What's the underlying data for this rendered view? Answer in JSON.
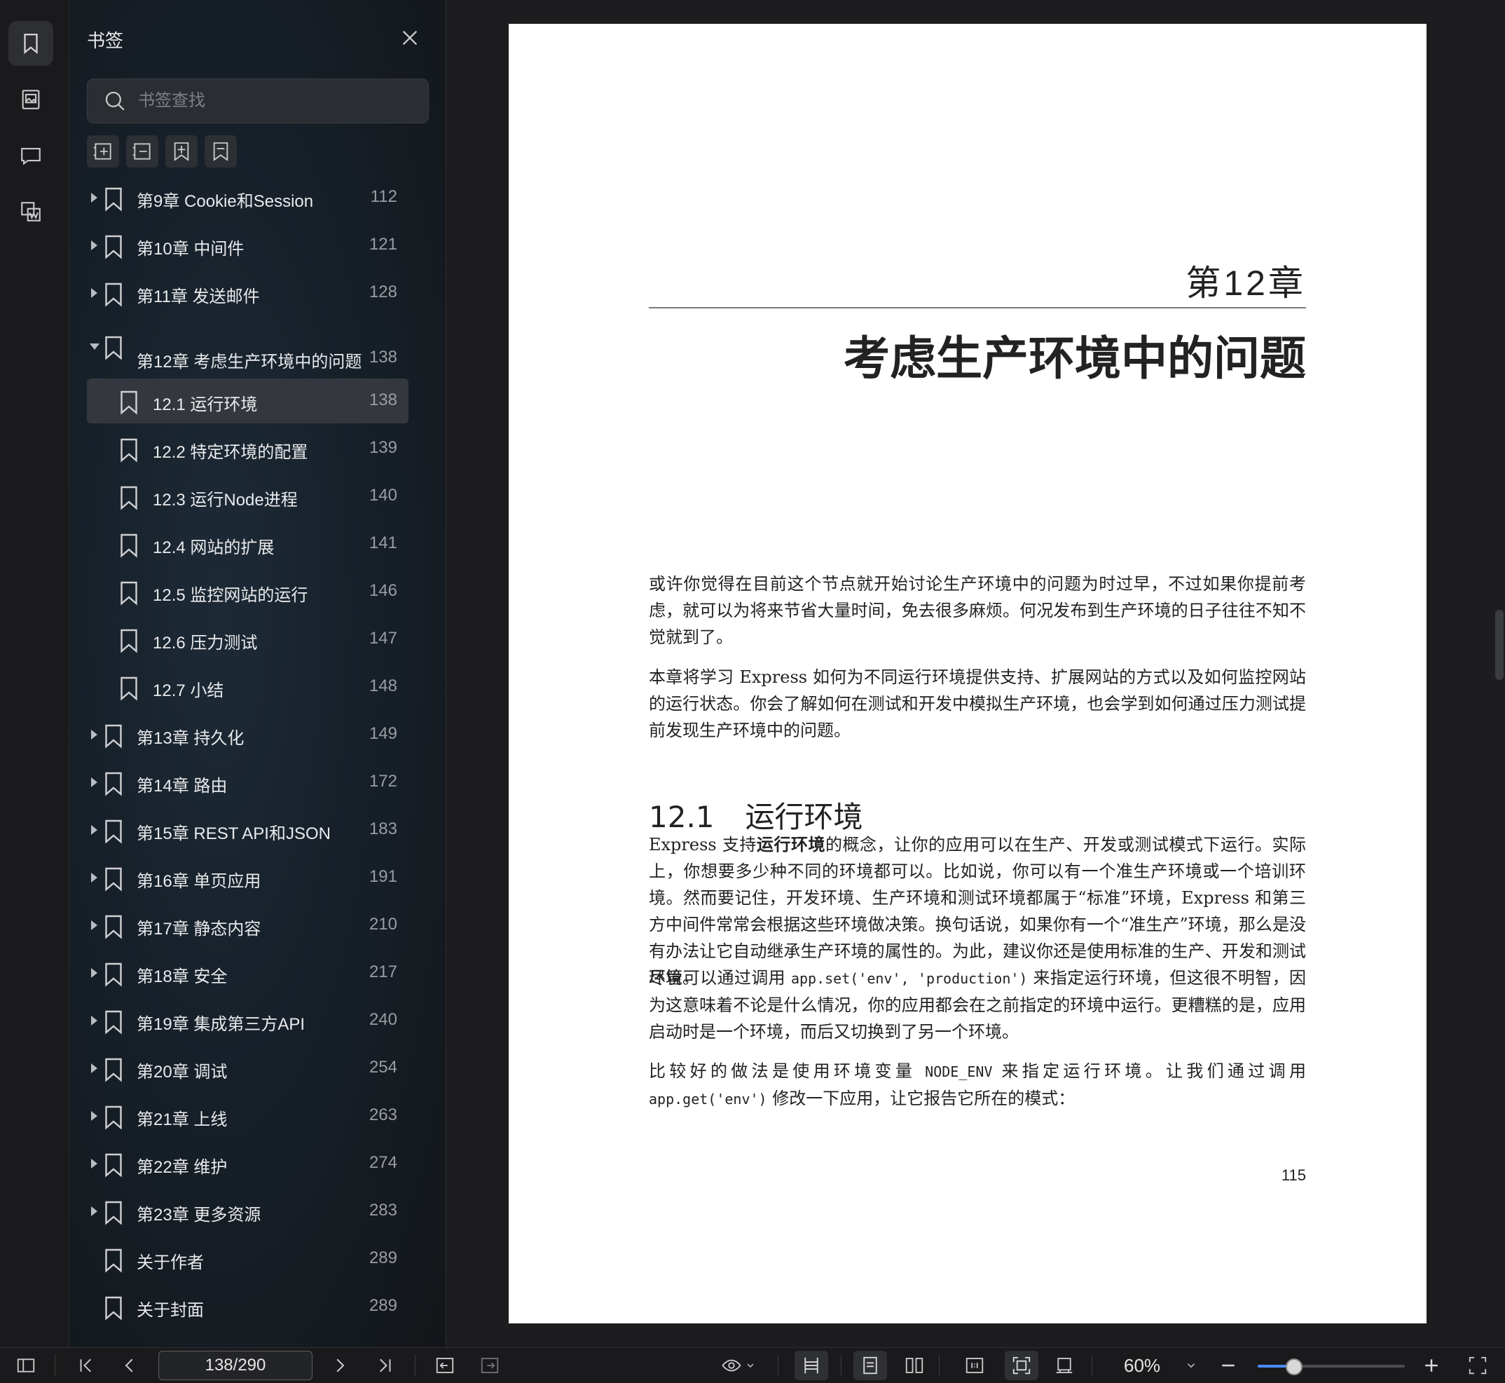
{
  "panel": {
    "title": "书签",
    "search_placeholder": "书签查找"
  },
  "bookmarks": [
    {
      "label": "第9章 Cookie和Session",
      "page": "112"
    },
    {
      "label": "第10章 中间件",
      "page": "121"
    },
    {
      "label": "第11章 发送邮件",
      "page": "128"
    },
    {
      "label": "第12章 考虑生产环境中的问题",
      "page": "138"
    },
    {
      "label": "12.1 运行环境",
      "page": "138"
    },
    {
      "label": "12.2 特定环境的配置",
      "page": "139"
    },
    {
      "label": "12.3 运行Node进程",
      "page": "140"
    },
    {
      "label": "12.4 网站的扩展",
      "page": "141"
    },
    {
      "label": "12.5 监控网站的运行",
      "page": "146"
    },
    {
      "label": "12.6 压力测试",
      "page": "147"
    },
    {
      "label": "12.7 小结",
      "page": "148"
    },
    {
      "label": "第13章 持久化",
      "page": "149"
    },
    {
      "label": "第14章 路由",
      "page": "172"
    },
    {
      "label": "第15章 REST API和JSON",
      "page": "183"
    },
    {
      "label": "第16章 单页应用",
      "page": "191"
    },
    {
      "label": "第17章 静态内容",
      "page": "210"
    },
    {
      "label": "第18章 安全",
      "page": "217"
    },
    {
      "label": "第19章 集成第三方API",
      "page": "240"
    },
    {
      "label": "第20章 调试",
      "page": "254"
    },
    {
      "label": "第21章 上线",
      "page": "263"
    },
    {
      "label": "第22章 维护",
      "page": "274"
    },
    {
      "label": "第23章 更多资源",
      "page": "283"
    },
    {
      "label": "关于作者",
      "page": "289"
    },
    {
      "label": "关于封面",
      "page": "289"
    }
  ],
  "document": {
    "chapter_number": "第12章",
    "chapter_title": "考虑生产环境中的问题",
    "p1": "或许你觉得在目前这个节点就开始讨论生产环境中的问题为时过早，不过如果你提前考虑，就可以为将来节省大量时间，免去很多麻烦。何况发布到生产环境的日子往往不知不觉就到了。",
    "p2": "本章将学习 Express 如何为不同运行环境提供支持、扩展网站的方式以及如何监控网站的运行状态。你会了解如何在测试和开发中模拟生产环境，也会学到如何通过压力测试提前发现生产环境中的问题。",
    "section_number": "12.1",
    "section_title": "运行环境",
    "p3_a": "Express 支持",
    "p3_bold": "运行环境",
    "p3_b": "的概念，让你的应用可以在生产、开发或测试模式下运行。实际上，你想要多少种不同的环境都可以。比如说，你可以有一个准生产环境或一个培训环境。然而要记住，开发环境、生产环境和测试环境都属于“标准”环境，Express 和第三方中间件常常会根据这些环境做决策。换句话说，如果你有一个“准生产”环境，那么是没有办法让它自动继承生产环境的属性的。为此，建议你还是使用标准的生产、开发和测试环境。",
    "p4_a": "尽管可以通过调用 ",
    "p4_code": "app.set('env', 'production')",
    "p4_b": " 来指定运行环境，但这很不明智，因为这意味着不论是什么情况，你的应用都会在之前指定的环境中运行。更糟糕的是，应用启动时是一个环境，而后又切换到了另一个环境。",
    "p5_a": "比较好的做法是使用环境变量 ",
    "p5_code1": "NODE_ENV",
    "p5_b": " 来指定运行环境。让我们通过调用 ",
    "p5_code2": "app.get('env')",
    "p5_c": " 修改一下应用，让它报告它所在的模式：",
    "page_number": "115"
  },
  "statusbar": {
    "page_indicator": "138/290",
    "zoom": "60%",
    "zoom_fraction": 0.24
  }
}
